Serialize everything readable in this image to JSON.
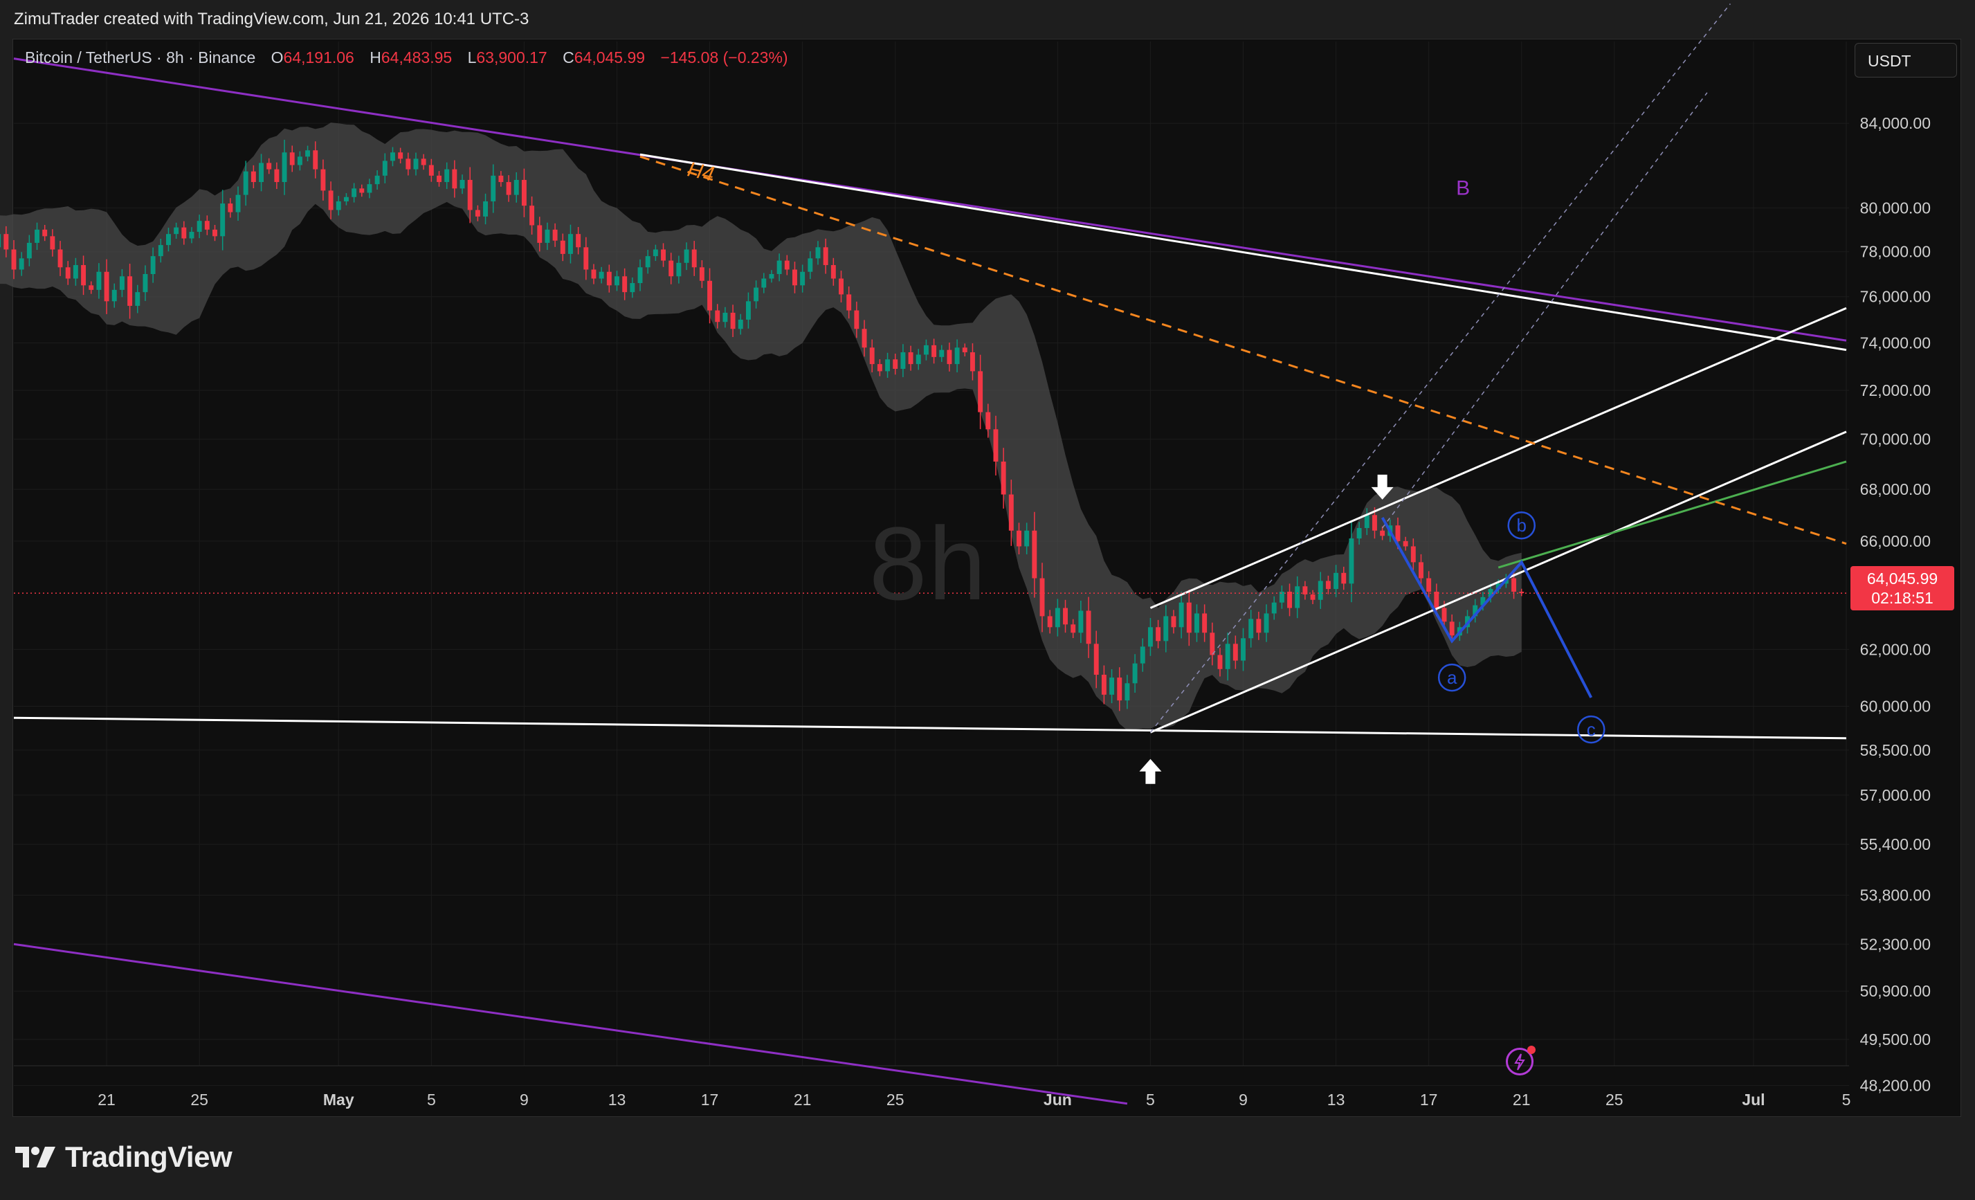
{
  "header": {
    "caption": "ZimuTrader created with TradingView.com, Jun 21, 2026 10:41 UTC-3"
  },
  "legend": {
    "symbol": "Bitcoin / TetherUS · 8h · Binance",
    "open_label": "O",
    "open": "64,191.06",
    "high_label": "H",
    "high": "64,483.95",
    "low_label": "L",
    "low": "63,900.17",
    "close_label": "C",
    "close": "64,045.99",
    "change": "−145.08 (−0.23%)"
  },
  "currency": "USDT",
  "price_tag": {
    "price": "64,045.99",
    "countdown": "02:18:51"
  },
  "watermark": "8h",
  "brand": "TradingView",
  "colors": {
    "up": "#089981",
    "down": "#f23645",
    "band": "#4a4a4a",
    "purple": "#8e2fc4",
    "orange": "#f5861f",
    "blue": "#2650d8",
    "green": "#4caf50",
    "white": "#ffffff"
  },
  "chart_data": {
    "type": "candlestick",
    "title": "Bitcoin / TetherUS · 8h · Binance",
    "timeframe": "8h",
    "x_ticks": [
      "21",
      "25",
      "May",
      "5",
      "9",
      "13",
      "17",
      "21",
      "25",
      "Jun",
      "5",
      "9",
      "13",
      "17",
      "21",
      "25",
      "Jul",
      "5"
    ],
    "y_ticks": [
      "84,000.00",
      "80,000.00",
      "78,000.00",
      "76,000.00",
      "74,000.00",
      "72,000.00",
      "70,000.00",
      "68,000.00",
      "66,000.00",
      "62,000.00",
      "60,000.00",
      "58,500.00",
      "57,000.00",
      "55,400.00",
      "53,800.00",
      "52,300.00",
      "50,900.00",
      "49,500.00",
      "48,200.00"
    ],
    "y_scale": "log",
    "ylim": [
      47600,
      87500
    ],
    "xlim": [
      "2026-04-17",
      "2026-07-05"
    ],
    "last_price": 64045.99,
    "closes": [
      76400,
      75900,
      75300,
      76200,
      75600,
      74800,
      75500,
      74100,
      74600,
      75400,
      75000,
      75300,
      76000,
      76600,
      77300,
      76800,
      76400,
      77200,
      78600,
      79300,
      78800,
      79200,
      78200,
      77600,
      78100,
      77800,
      78600,
      78300,
      77600,
      77900,
      78200,
      78800,
      78100,
      77200,
      77700,
      78400,
      79000,
      78700,
      78100,
      77300,
      76800,
      77400,
      76500,
      76300,
      77100,
      75800,
      76300,
      76900,
      75600,
      76200,
      77000,
      77800,
      78300,
      78800,
      79100,
      78600,
      78900,
      79400,
      79000,
      78700,
      80200,
      79800,
      80600,
      81700,
      81200,
      82100,
      81800,
      81200,
      82600,
      82000,
      82400,
      82700,
      81800,
      80800,
      79900,
      80300,
      80500,
      80900,
      80700,
      81100,
      81500,
      82200,
      82600,
      82300,
      81800,
      82300,
      82000,
      81500,
      81200,
      81800,
      80900,
      81300,
      79900,
      79600,
      80300,
      81500,
      81200,
      80600,
      81300,
      80100,
      79200,
      78400,
      79000,
      78500,
      77900,
      78800,
      78200,
      77200,
      76800,
      77100,
      76500,
      76900,
      76200,
      76600,
      77300,
      77800,
      78100,
      77600,
      76900,
      77500,
      78100,
      77300,
      76700,
      75400,
      74900,
      75300,
      74600,
      75000,
      75800,
      76400,
      76800,
      77000,
      77600,
      77200,
      76500,
      77100,
      77700,
      78200,
      77400,
      76800,
      76100,
      75400,
      74600,
      73800,
      73100,
      72800,
      73300,
      72900,
      73600,
      73100,
      73500,
      73900,
      73400,
      73700,
      73100,
      73800,
      73600,
      72800,
      71100,
      70400,
      69100,
      67800,
      66400,
      65800,
      66400,
      64600,
      63200,
      62800,
      63500,
      62900,
      62600,
      63400,
      62200,
      61100,
      60400,
      61000,
      60200,
      60800,
      61500,
      62100,
      62800,
      62300,
      63200,
      62800,
      63700,
      62600,
      63300,
      62600,
      61800,
      61300,
      62200,
      61600,
      62400,
      63100,
      62600,
      63300,
      63700,
      64100,
      63500,
      64300,
      64000,
      63800,
      64500,
      64200,
      64800,
      64400,
      66100,
      66500,
      67000,
      66400,
      66200,
      66600,
      66000,
      65800,
      65200,
      64600,
      64100,
      63500,
      63000,
      62500,
      62800,
      63200,
      63600,
      63900,
      64200,
      64400,
      64600,
      64100,
      64046
    ],
    "drawings": {
      "labels": [
        "B",
        "a",
        "b",
        "c",
        "H4"
      ]
    }
  }
}
